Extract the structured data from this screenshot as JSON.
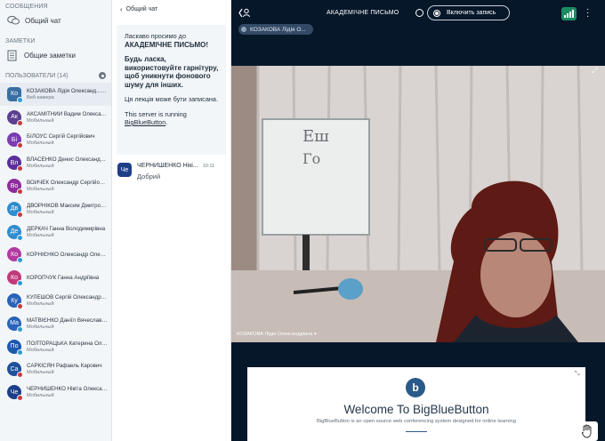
{
  "sidebar": {
    "messages_header": "СООБЩЕНИЯ",
    "public_chat": "Общий чат",
    "notes_header": "ЗАМЕТКИ",
    "shared_notes": "Общие заметки",
    "users_header": "ПОЛЬЗОВАТЕЛИ (14)",
    "users": [
      {
        "initials": "Ко",
        "name": "КОЗАКОВА Лідія Олександ... (Вы)",
        "sub": "Веб-камера",
        "color": "#3a6ea5",
        "badge": "#2d9bd3",
        "shape": "square"
      },
      {
        "initials": "Ак",
        "name": "АКСАМІТНИЙ Вадим Олександ...",
        "sub": "Мобильный",
        "color": "#5c3f8f",
        "badge": "#c93b3b",
        "shape": "circle"
      },
      {
        "initials": "Бі",
        "name": "БІЛОУС Сергій Сергійович",
        "sub": "Мобильный",
        "color": "#7a3db0",
        "badge": "#c93b3b",
        "shape": "circle"
      },
      {
        "initials": "Вл",
        "name": "ВЛАСЕНКО Денис Олександро...",
        "sub": "Мобильный",
        "color": "#5b2f9a",
        "badge": "#c93b3b",
        "shape": "circle"
      },
      {
        "initials": "Во",
        "name": "ВОЙЧЕК Олександр Сергійович",
        "sub": "Мобильный",
        "color": "#8e2d9e",
        "badge": "#c93b3b",
        "shape": "circle"
      },
      {
        "initials": "Дв",
        "name": "ДВОРНІКОВ Максим Дмитрович",
        "sub": "Мобильный",
        "color": "#2f8ccf",
        "badge": "#c93b3b",
        "shape": "circle"
      },
      {
        "initials": "Де",
        "name": "ДЕРКАЧ Ганна Володимирівна",
        "sub": "Мобильный",
        "color": "#2f8ccf",
        "badge": "#2d9bd3",
        "shape": "circle"
      },
      {
        "initials": "Ко",
        "name": "КОРНІЄНКО Олександр Олегов...",
        "sub": "",
        "color": "#b23aa0",
        "badge": "#2d9bd3",
        "shape": "circle"
      },
      {
        "initials": "Ко",
        "name": "КОРОПЧУК Ганна Андріївна",
        "sub": "",
        "color": "#c23a7a",
        "badge": "#2d9bd3",
        "shape": "circle"
      },
      {
        "initials": "Ку",
        "name": "КУЛЕШОВ Сергій Олександрович",
        "sub": "Мобильный",
        "color": "#2a63b8",
        "badge": "#c93b3b",
        "shape": "circle"
      },
      {
        "initials": "Ма",
        "name": "МАТВІЄНКО Даніїл Вячеславов...",
        "sub": "Мобильный",
        "color": "#2a63b8",
        "badge": "#2d9bd3",
        "shape": "circle"
      },
      {
        "initials": "По",
        "name": "ПОЛТОРАЦЬКА Катерина Олекс...",
        "sub": "Мобильный",
        "color": "#1f58b0",
        "badge": "#2d9bd3",
        "shape": "circle"
      },
      {
        "initials": "Са",
        "name": "САРКІСЯН Рафаель Карович",
        "sub": "Мобильный",
        "color": "#1e4f9c",
        "badge": "#c93b3b",
        "shape": "circle"
      },
      {
        "initials": "Че",
        "name": "ЧЕРНИШЕНКО Нікіта Олександ...",
        "sub": "Мобильный",
        "color": "#1d3f8a",
        "badge": "#c93b3b",
        "shape": "circle"
      }
    ]
  },
  "chat": {
    "back_label": "Общий чат",
    "welcome_line1": "Ласкаво просимо до",
    "welcome_line2": "АКАДЕМІЧНЕ ПИСЬМО!",
    "welcome_line3": "Будь ласка,",
    "welcome_line4": "використовуйте гарнітуру,",
    "welcome_line5": "щоб уникнути фонового",
    "welcome_line6": "шуму для інших.",
    "welcome_line7": "Ця лекція може бути записана.",
    "welcome_line8": "This server is running",
    "welcome_line9": "BigBlueButton",
    "welcome_dot": ".",
    "message": {
      "initials": "Че",
      "name": "ЧЕРНИШЕНКО Нікі...",
      "time": "10:11",
      "text": "Добрий",
      "color": "#1d3f8a"
    }
  },
  "main": {
    "title": "АКАДЕМІЧНЕ ПИСЬМО",
    "record_label": "Включить запись",
    "talking_user": "КОЗАКОВА Лідія О...",
    "video_label": "КОЗАКОВА Лідія Олександрівна ▾",
    "slide_title": "Welcome To BigBlueButton",
    "slide_subtitle": "BigBlueButton is an open source web conferencing system designed for online learning",
    "slide_logo": "b",
    "accent": "#1a8d60"
  }
}
